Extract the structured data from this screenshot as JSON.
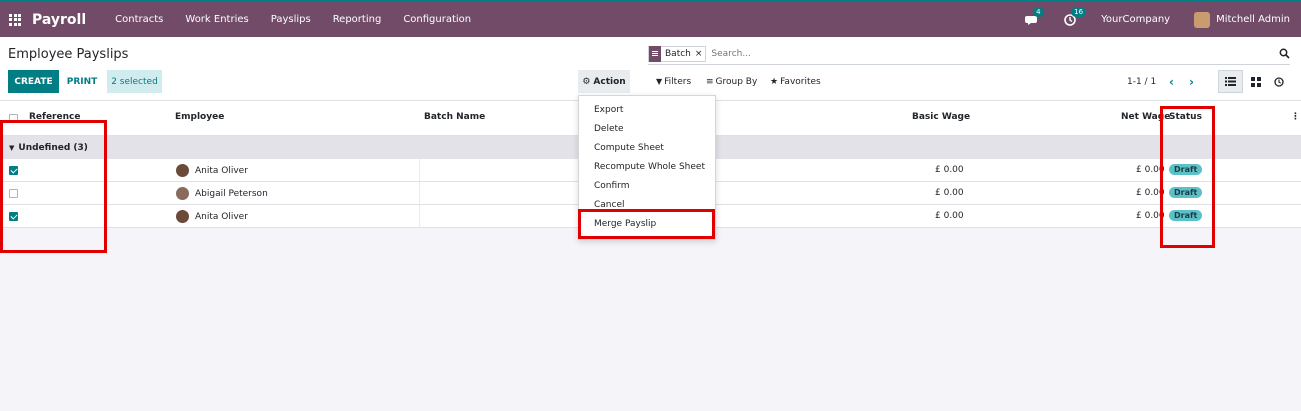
{
  "navbar": {
    "app_name": "Payroll",
    "menu": [
      "Contracts",
      "Work Entries",
      "Payslips",
      "Reporting",
      "Configuration"
    ],
    "messages_count": "4",
    "activities_count": "16",
    "company": "YourCompany",
    "user": "Mitchell Admin"
  },
  "control_panel": {
    "title": "Employee Payslips",
    "create_label": "CREATE",
    "print_label": "PRINT",
    "selected_label": "2 selected",
    "search": {
      "facet": "Batch",
      "facet_remove": "×",
      "placeholder": "Search..."
    },
    "action_label": "Action",
    "filters_label": "Filters",
    "group_by_label": "Group By",
    "favorites_label": "Favorites",
    "pager": "1-1 / 1"
  },
  "action_menu": {
    "items": [
      "Export",
      "Delete",
      "Compute Sheet",
      "Recompute Whole Sheet",
      "Confirm",
      "Cancel",
      "Merge Payslip"
    ]
  },
  "table": {
    "columns": {
      "reference": "Reference",
      "employee": "Employee",
      "batch": "Batch Name",
      "basic_wage": "Basic Wage",
      "net_wage": "Net Wage",
      "status": "Status"
    },
    "group_label": "Undefined (3)",
    "rows": [
      {
        "employee": "Anita Oliver",
        "basic_wage": "£ 0.00",
        "net_wage": "£ 0.00",
        "status": "Draft",
        "checked": true
      },
      {
        "employee": "Abigail Peterson",
        "basic_wage": "£ 0.00",
        "net_wage": "£ 0.00",
        "status": "Draft",
        "checked": false
      },
      {
        "employee": "Anita Oliver",
        "basic_wage": "£ 0.00",
        "net_wage": "£ 0.00",
        "status": "Draft",
        "checked": true
      }
    ]
  },
  "colors": {
    "brand": "#714b67",
    "accent": "#017e84",
    "highlight": "#e00000",
    "status_draft": "#5bc0c8"
  }
}
